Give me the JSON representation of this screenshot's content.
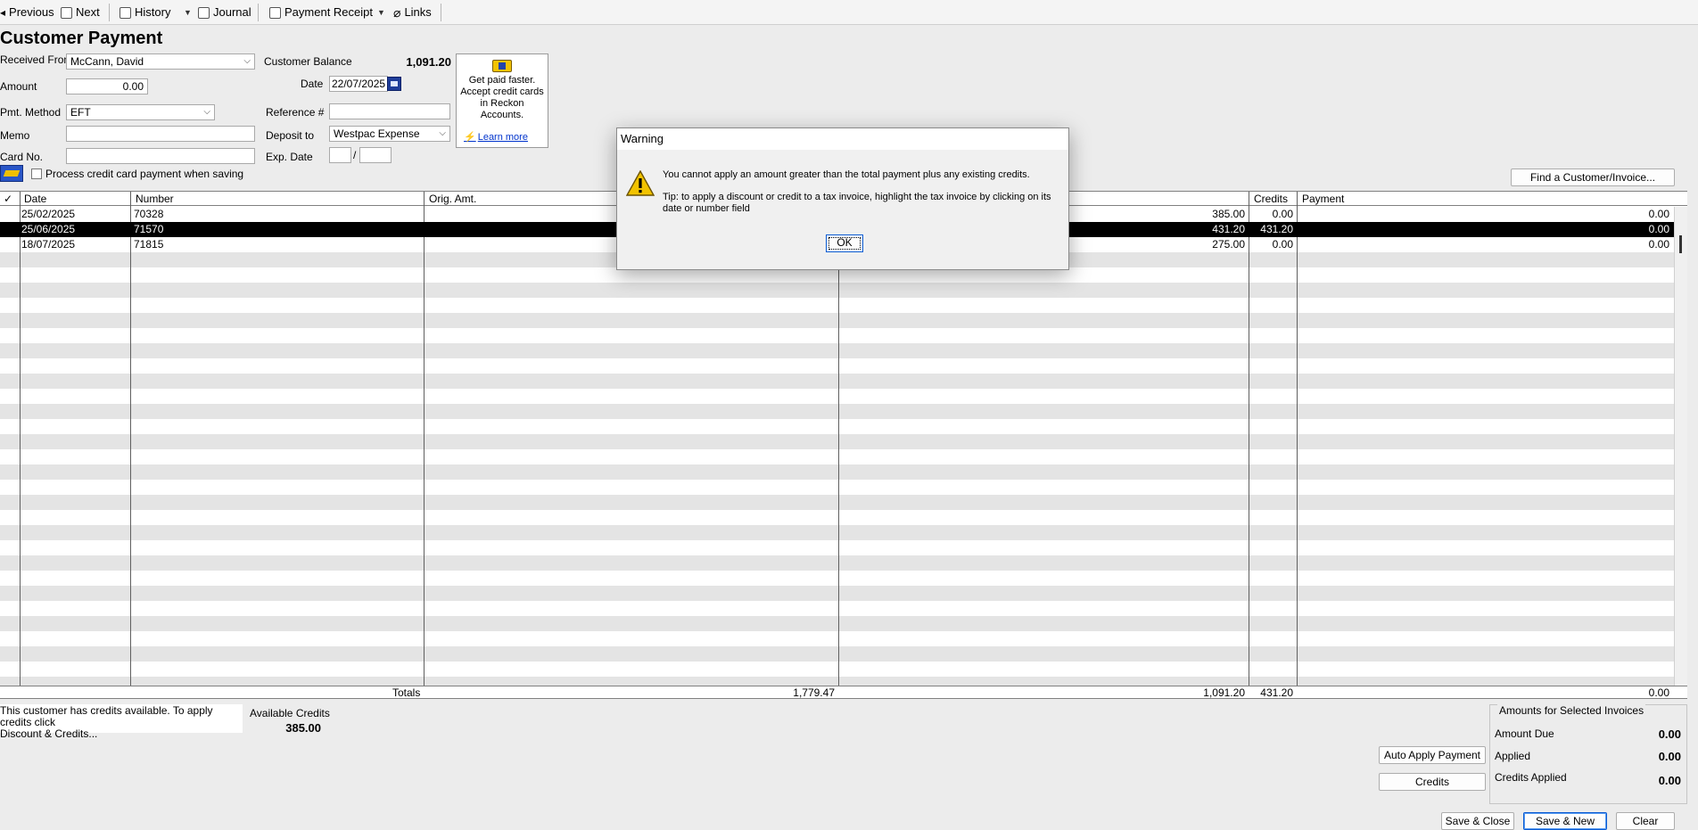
{
  "toolbar": {
    "previous": "Previous",
    "next": "Next",
    "history": "History",
    "journal": "Journal",
    "payment_receipt": "Payment Receipt",
    "links": "Links"
  },
  "title": "Customer Payment",
  "form": {
    "received_from_label": "Received From",
    "received_from": "McCann, David",
    "customer_balance_label": "Customer Balance",
    "customer_balance": "1,091.20",
    "amount_label": "Amount",
    "amount": "0.00",
    "date_label": "Date",
    "date": "22/07/2025",
    "pmt_method_label": "Pmt. Method",
    "pmt_method": "EFT",
    "reference_label": "Reference #",
    "reference": "",
    "memo_label": "Memo",
    "memo": "",
    "deposit_to_label": "Deposit to",
    "deposit_to": "Westpac Expense",
    "card_no_label": "Card No.",
    "card_no": "",
    "exp_date_label": "Exp. Date",
    "exp_separator": "/",
    "process_cc_label": "Process credit card payment when saving"
  },
  "promo": {
    "line1": "Get paid faster.",
    "line2": "Accept credit cards",
    "line3": "in  Reckon",
    "line4": "Accounts.",
    "link": "Learn more"
  },
  "find_button": "Find a Customer/Invoice...",
  "table": {
    "headers": {
      "check": "✓",
      "date": "Date",
      "number": "Number",
      "orig_amt": "Orig. Amt.",
      "credits": "Credits",
      "payment": "Payment"
    },
    "rows": [
      {
        "date": "25/02/2025",
        "number": "70328",
        "amt_due": "385.00",
        "credits": "0.00",
        "payment": "0.00"
      },
      {
        "date": "25/06/2025",
        "number": "71570",
        "amt_due": "431.20",
        "credits": "431.20",
        "payment": "0.00"
      },
      {
        "date": "18/07/2025",
        "number": "71815",
        "amt_due": "275.00",
        "credits": "0.00",
        "payment": "0.00"
      }
    ],
    "totals": {
      "label": "Totals",
      "orig_amt": "1,779.47",
      "amt_due": "1,091.20",
      "credits": "431.20",
      "payment": "0.00"
    }
  },
  "bottom": {
    "credits_note_line1": "This customer has credits available. To apply credits click",
    "credits_note_line2": "Discount & Credits...",
    "available_credits_label": "Available Credits",
    "available_credits": "385.00",
    "auto_apply": "Auto Apply Payment",
    "credits_button": "Credits",
    "amounts_title": "Amounts for Selected Invoices",
    "amount_due_label": "Amount Due",
    "amount_due": "0.00",
    "applied_label": "Applied",
    "applied": "0.00",
    "credits_applied_label": "Credits Applied",
    "credits_applied": "0.00",
    "save_close": "Save & Close",
    "save_new": "Save & New",
    "clear": "Clear"
  },
  "dialog": {
    "title": "Warning",
    "message": "You cannot apply an amount greater than the total payment plus any existing credits.",
    "tip_line1": "Tip: to apply a discount or credit to a tax invoice, highlight the tax invoice by clicking on its",
    "tip_line2": "date or number field",
    "ok": "OK"
  },
  "colors": {
    "selected_row": "#000000",
    "link": "#0033cc",
    "accent_button": "#0a5bd3",
    "warning_icon": "#f2c300"
  },
  "icons": {
    "previous": "arrow-left-icon",
    "next": "arrow-right-icon",
    "history": "history-icon",
    "journal": "journal-icon",
    "payment_receipt": "printer-icon",
    "links": "paperclip-icon",
    "date_picker": "calendar-icon",
    "promo": "credit-card-icon",
    "warning": "warning-triangle-icon"
  }
}
